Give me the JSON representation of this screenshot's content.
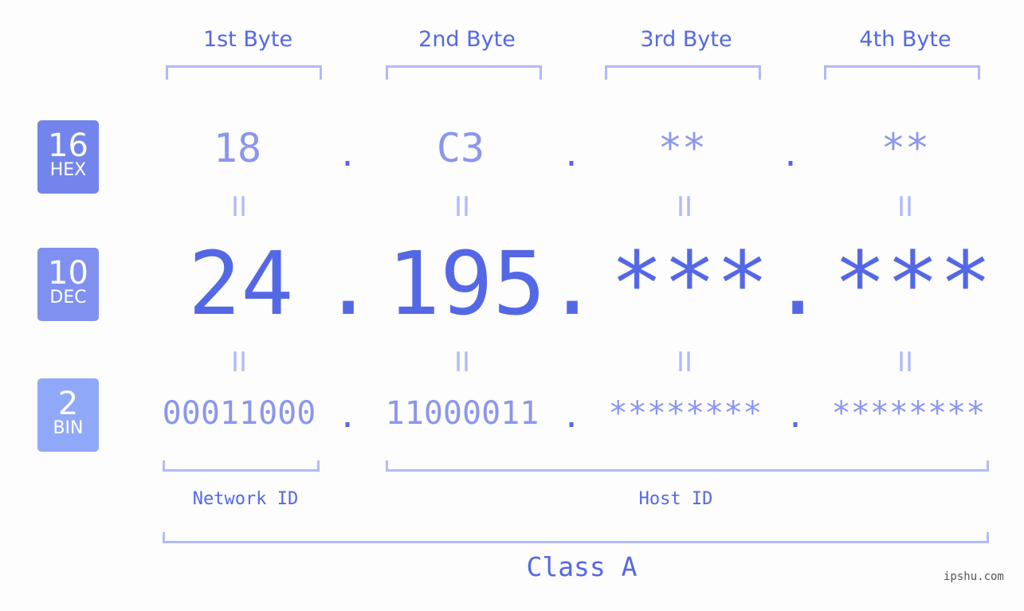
{
  "bytes": [
    {
      "header": "1st Byte",
      "hex": "18",
      "dec": "24",
      "bin": "00011000"
    },
    {
      "header": "2nd Byte",
      "hex": "C3",
      "dec": "195",
      "bin": "11000011"
    },
    {
      "header": "3rd Byte",
      "hex": "**",
      "dec": "***",
      "bin": "********"
    },
    {
      "header": "4th Byte",
      "hex": "**",
      "dec": "***",
      "bin": "********"
    }
  ],
  "badges": {
    "hex": {
      "num": "16",
      "label": "HEX",
      "color": "#7384ec"
    },
    "dec": {
      "num": "10",
      "label": "DEC",
      "color": "#8090f0"
    },
    "bin": {
      "num": "2",
      "label": "BIN",
      "color": "#90a8f8"
    }
  },
  "separator": ".",
  "equals": "II",
  "network_label": "Network ID",
  "host_label": "Host ID",
  "class_label": "Class A",
  "watermark": "ipshu.com"
}
